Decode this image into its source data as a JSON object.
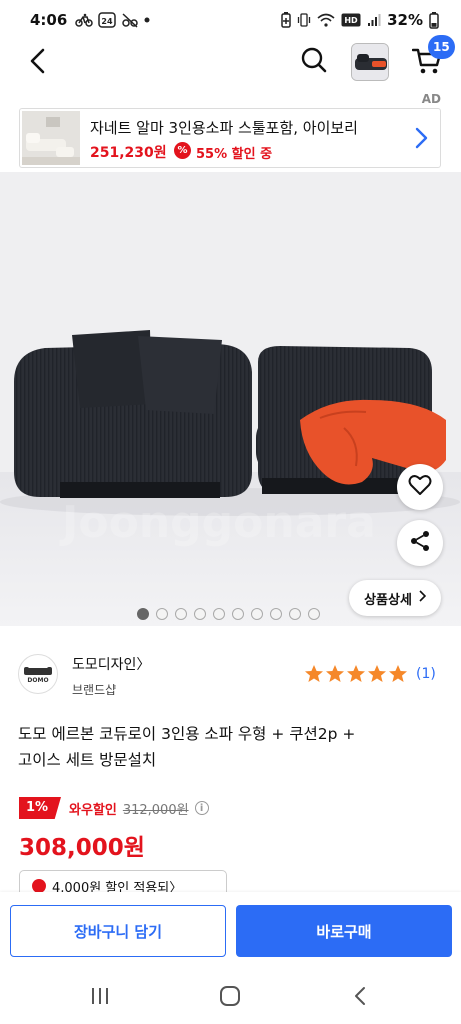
{
  "status_bar": {
    "time": "4:06",
    "battery": "32%",
    "left_icons": [
      "bike-icon",
      "calendar-24-icon",
      "no-signal-bike-icon",
      "dot-icon"
    ],
    "right_icons": [
      "battery-saver-icon",
      "vibrate-icon",
      "wifi-icon",
      "volte-icon",
      "signal-icon",
      "battery-icon"
    ],
    "calendar_badge": "24",
    "volte_label": "HD"
  },
  "top_nav": {
    "back_icon": "chevron-left-icon",
    "search_icon": "search-icon",
    "cart_icon": "cart-icon",
    "cart_count": "15"
  },
  "ad": {
    "label": "AD",
    "title": "자네트 알마 3인용소파 스툴포함, 아이보리",
    "price": "251,230원",
    "discount_icon_text": "%",
    "discount": "55% 할인 중"
  },
  "hero": {
    "watermark": "Joonggonara",
    "detail_label": "상품상세",
    "dots_total": 10,
    "dots_active_index": 0
  },
  "seller": {
    "logo_text": "DOMO",
    "name": "도모디자인〉",
    "subtitle": "브랜드샵",
    "rating_stars": 5,
    "review_count": "(1)"
  },
  "product": {
    "title_line1": "도모 에르본 코듀로이 3인용 소파 우형 + 쿠션2p +",
    "title_line2": "고이스 세트 방문설치",
    "wow_discount": "1%",
    "wow_label": "와우할인",
    "original_price": "312,000원",
    "info_icon": "i",
    "final_price": "308,000원",
    "coupon_text": "4,000원  할인 적용되〉"
  },
  "bottom_bar": {
    "cart_button": "장바구니 담기",
    "buy_button": "바로구매"
  },
  "colors": {
    "accent_blue": "#2c6cf5",
    "sale_red": "#e3131d",
    "star_orange": "#f5882a"
  }
}
